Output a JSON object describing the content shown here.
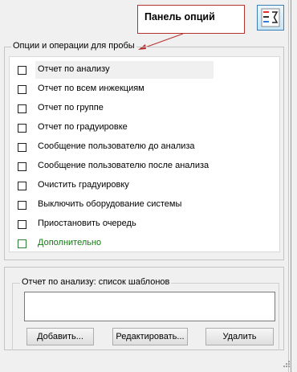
{
  "callout": {
    "text": "Панель  опций"
  },
  "options_group": {
    "title": "Опции и операции для пробы",
    "items": [
      {
        "label": "Отчет по анализу",
        "checked": false,
        "selected": true
      },
      {
        "label": "Отчет по всем инжекциям",
        "checked": false
      },
      {
        "label": "Отчет по группе",
        "checked": false
      },
      {
        "label": "Отчет по градуировке",
        "checked": false
      },
      {
        "label": "Сообщение пользователю до анализа",
        "checked": false
      },
      {
        "label": "Сообщение пользователю после анализа",
        "checked": false
      },
      {
        "label": "Очистить градуировку",
        "checked": false
      },
      {
        "label": "Выключить оборудование системы",
        "checked": false
      },
      {
        "label": "Приостановить очередь",
        "checked": false
      },
      {
        "label": "Дополнительно",
        "checked": false,
        "color": "#0b7d0b"
      }
    ]
  },
  "template_group": {
    "title": "Отчет по анализу: список шаблонов",
    "add_label": "Добавить...",
    "edit_label": "Редактировать...",
    "delete_label": "Удалить"
  },
  "colors": {
    "callout_border": "#b83030",
    "accent": "#0b7d0b"
  },
  "icons": {
    "panel_toggle": "options-panel-icon"
  }
}
